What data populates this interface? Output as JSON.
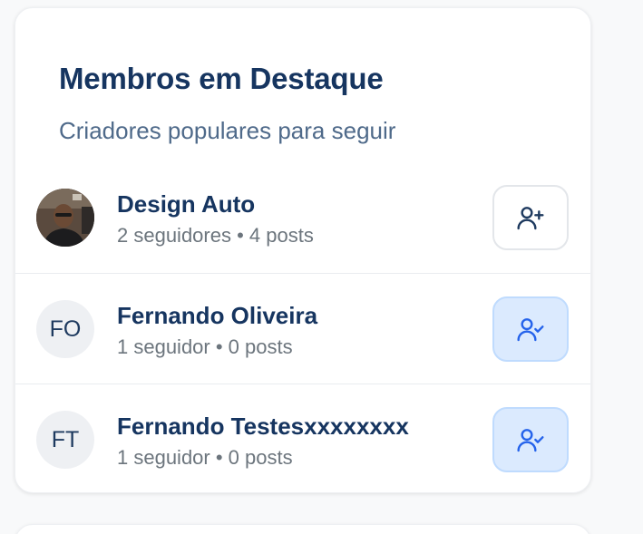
{
  "card": {
    "title": "Membros em Destaque",
    "subtitle": "Criadores populares para seguir"
  },
  "members": [
    {
      "name": "Design Auto",
      "meta": "2 seguidores • 4 posts",
      "initials": "",
      "has_photo": true,
      "following": false,
      "action_icon": "user-plus-icon"
    },
    {
      "name": "Fernando Oliveira",
      "meta": "1 seguidor • 0 posts",
      "initials": "FO",
      "has_photo": false,
      "following": true,
      "action_icon": "user-check-icon"
    },
    {
      "name": "Fernando Testesxxxxxxxx",
      "meta": "1 seguidor • 0 posts",
      "initials": "FT",
      "has_photo": false,
      "following": true,
      "action_icon": "user-check-icon"
    }
  ],
  "colors": {
    "title": "#163560",
    "subtitle": "#4f6a8a",
    "meta": "#6c757d",
    "following_bg": "#dbeafe",
    "icon_default": "#1e3a5f",
    "icon_following": "#2563eb"
  }
}
